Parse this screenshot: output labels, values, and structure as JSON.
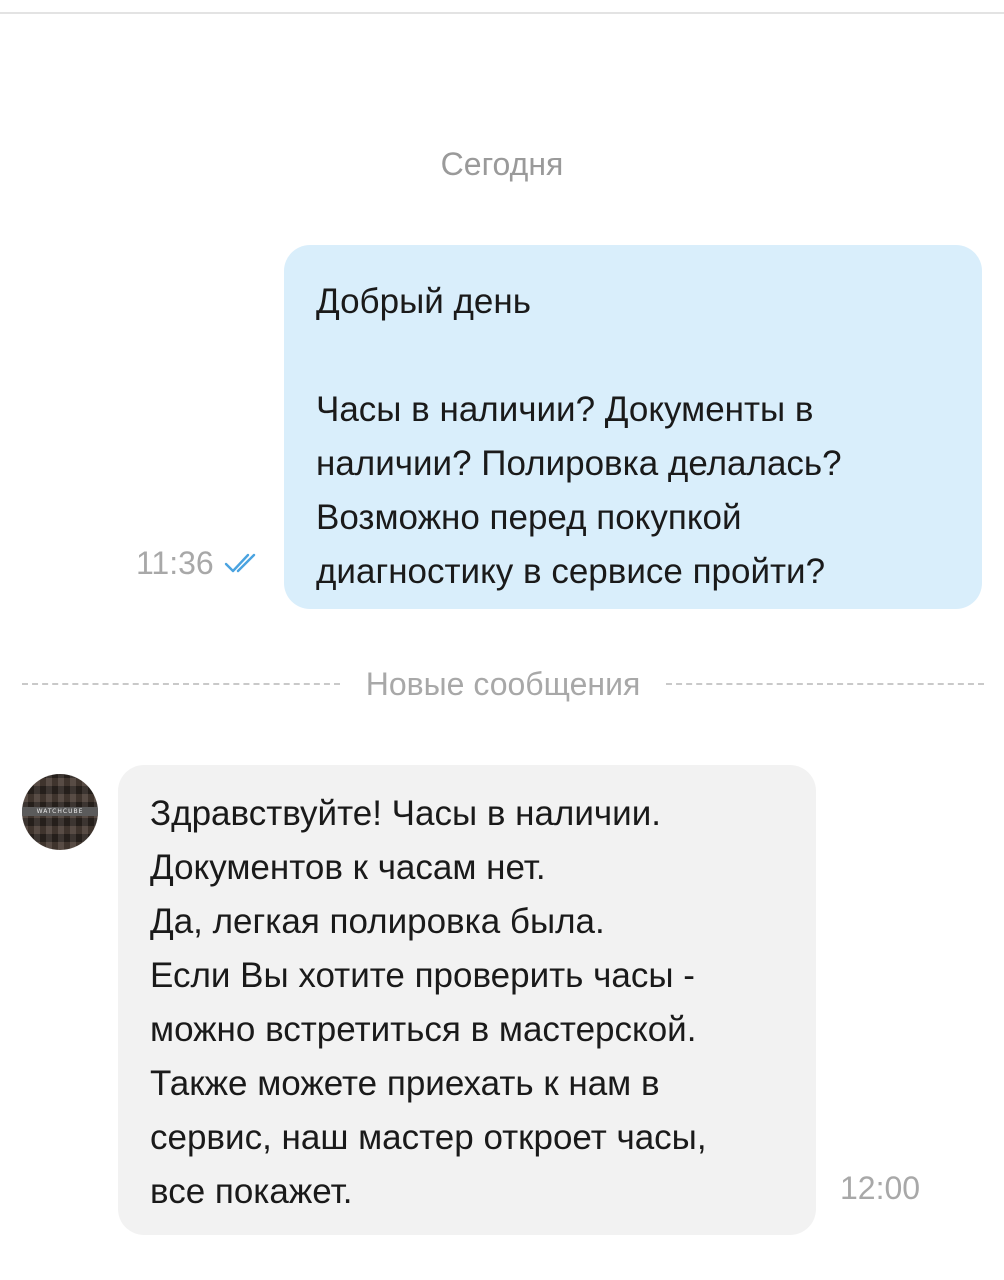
{
  "chat": {
    "date_label": "Сегодня",
    "new_messages_label": "Новые сообщения",
    "outgoing": {
      "lines": [
        "Добрый день",
        "",
        "Часы в наличии? Документы в",
        "наличии? Полировка делалась?",
        "Возможно перед покупкой",
        "диагностику в сервисе пройти?"
      ],
      "time": "11:36",
      "status_icon": "double-check-icon",
      "status_color": "#4aa3e0",
      "bubble_color": "#d9eefb"
    },
    "incoming": {
      "avatar_text": "WATCHCUBE",
      "lines": [
        "Здравствуйте! Часы в наличии.",
        "Документов к часам нет.",
        "Да, легкая полировка была.",
        "Если Вы хотите проверить часы -",
        "можно встретиться в мастерской.",
        "Также можете приехать к нам в",
        "сервис, наш мастер откроет часы,",
        "все покажет."
      ],
      "time": "12:00",
      "bubble_color": "#f2f2f2"
    }
  }
}
